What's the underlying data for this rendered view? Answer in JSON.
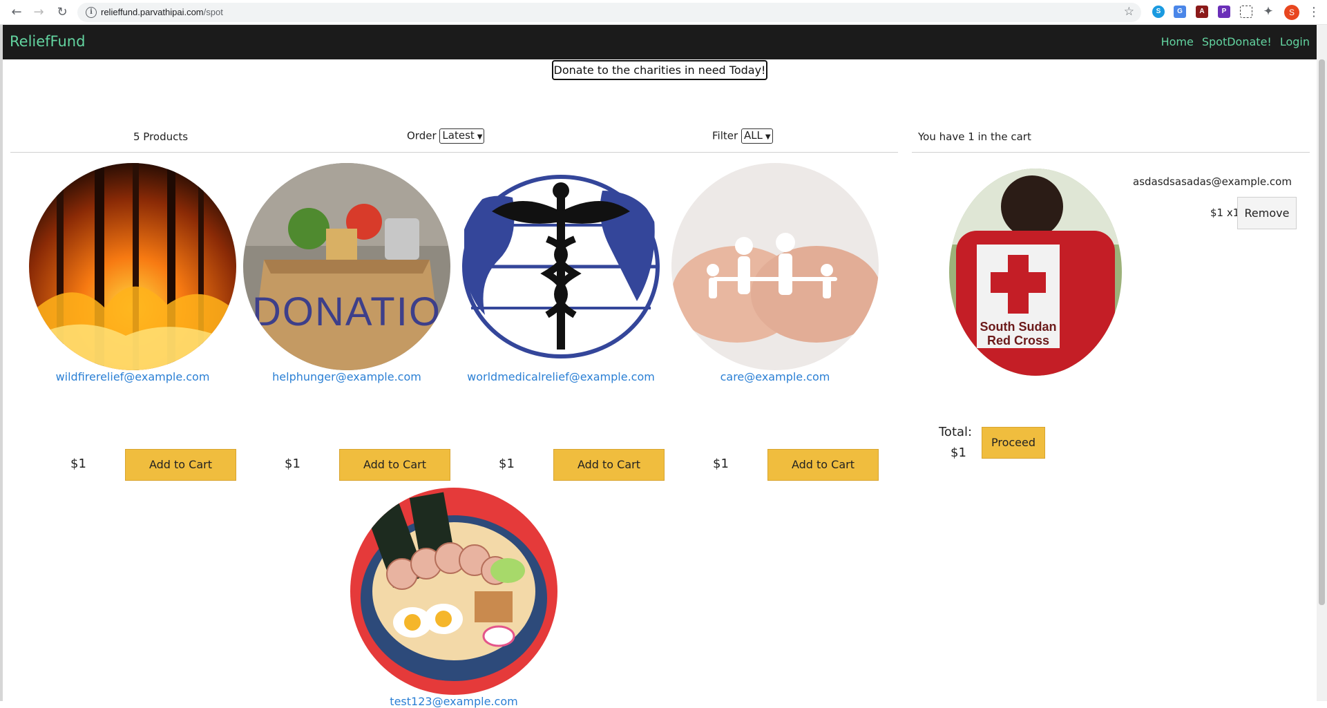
{
  "browser": {
    "url_host": "relieffund.parvathipai.com",
    "url_path": "/spot",
    "profile_initial": "S"
  },
  "navbar": {
    "brand": "ReliefFund",
    "links": [
      "Home",
      "SpotDonate!",
      "Login"
    ]
  },
  "banner": "Donate to the charities in need Today!",
  "products_header": {
    "count": "5 Products",
    "order_label": "Order",
    "order_value": "Latest",
    "filter_label": "Filter",
    "filter_value": "ALL"
  },
  "cart_header": "You have 1 in the cart",
  "products": [
    {
      "email": "wildfirerelief@example.com",
      "price": "$1",
      "button": "Add to Cart",
      "image": "wildfire-image"
    },
    {
      "email": "helphunger@example.com",
      "price": "$1",
      "button": "Add to Cart",
      "image": "donation-box-image"
    },
    {
      "email": "worldmedicalrelief@example.com",
      "price": "$1",
      "button": "Add to Cart",
      "image": "medical-globe-image"
    },
    {
      "email": "care@example.com",
      "price": "$1",
      "button": "Add to Cart",
      "image": "family-hands-image"
    },
    {
      "email": "test123@example.com",
      "image": "ramen-image"
    }
  ],
  "cart": {
    "item_email": "asdasdsasadas@example.com",
    "item_qty": "$1 x1",
    "remove_label": "Remove",
    "total_label": "Total:",
    "total_value": "$1",
    "proceed_label": "Proceed"
  },
  "colors": {
    "accent_green": "#63d4a0",
    "button_yellow": "#f0bd3e",
    "link_blue": "#2a7fd4",
    "navbar_bg": "#1b1b1b"
  }
}
